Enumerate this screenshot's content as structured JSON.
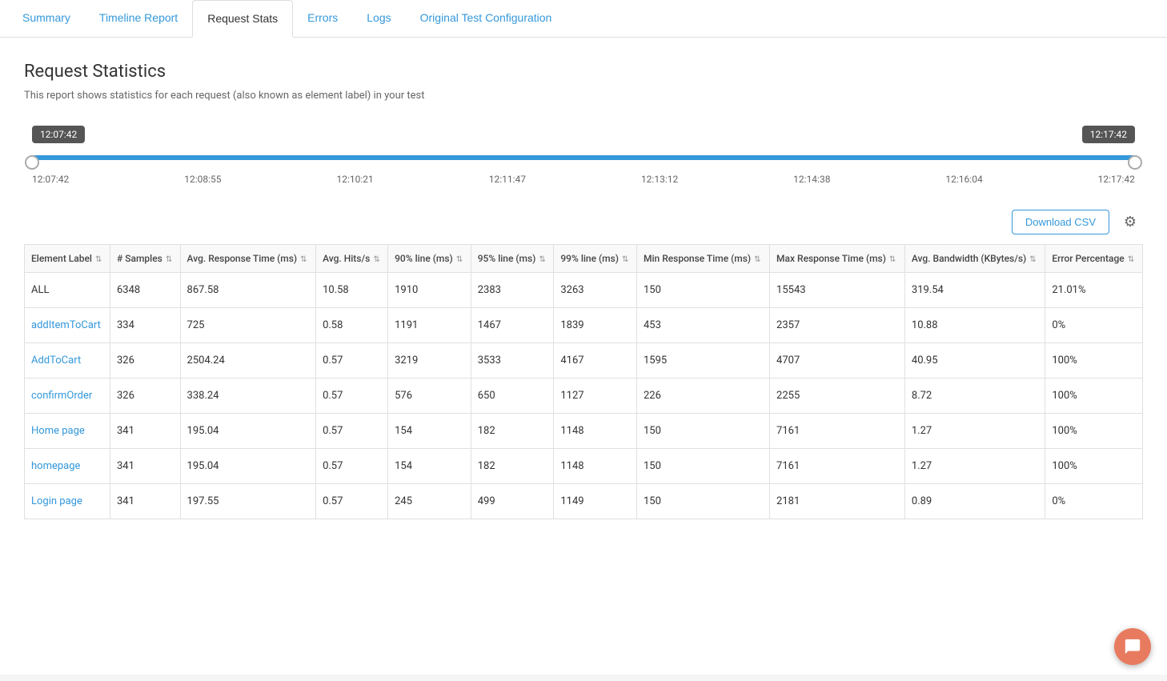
{
  "tabs": [
    {
      "id": "summary",
      "label": "Summary",
      "active": false
    },
    {
      "id": "timeline-report",
      "label": "Timeline Report",
      "active": false
    },
    {
      "id": "request-stats",
      "label": "Request Stats",
      "active": true
    },
    {
      "id": "errors",
      "label": "Errors",
      "active": false
    },
    {
      "id": "logs",
      "label": "Logs",
      "active": false
    },
    {
      "id": "original-test-config",
      "label": "Original Test Configuration",
      "active": false
    }
  ],
  "page": {
    "title": "Request Statistics",
    "subtitle": "This report shows statistics for each request (also known as element label) in your test"
  },
  "slider": {
    "start_time": "12:07:42",
    "end_time": "12:17:42",
    "time_labels": [
      "12:07:42",
      "12:08:55",
      "12:10:21",
      "12:11:47",
      "12:13:12",
      "12:14:38",
      "12:16:04",
      "12:17:42"
    ]
  },
  "toolbar": {
    "download_csv_label": "Download CSV"
  },
  "table": {
    "columns": [
      {
        "id": "element-label",
        "label": "Element Label",
        "sortable": true
      },
      {
        "id": "samples",
        "label": "# Samples",
        "sortable": true
      },
      {
        "id": "avg-response-time",
        "label": "Avg. Response Time (ms)",
        "sortable": true
      },
      {
        "id": "avg-hits",
        "label": "Avg. Hits/s",
        "sortable": true
      },
      {
        "id": "90line",
        "label": "90% line (ms)",
        "sortable": true
      },
      {
        "id": "95line",
        "label": "95% line (ms)",
        "sortable": true
      },
      {
        "id": "99line",
        "label": "99% line (ms)",
        "sortable": true
      },
      {
        "id": "min-response",
        "label": "Min Response Time (ms)",
        "sortable": true
      },
      {
        "id": "max-response",
        "label": "Max Response Time (ms)",
        "sortable": true
      },
      {
        "id": "avg-bandwidth",
        "label": "Avg. Bandwidth (KBytes/s)",
        "sortable": true
      },
      {
        "id": "error-pct",
        "label": "Error Percentage",
        "sortable": true
      }
    ],
    "rows": [
      {
        "label": "ALL",
        "samples": "6348",
        "avg_response": "867.58",
        "avg_hits": "10.58",
        "p90": "1910",
        "p95": "2383",
        "p99": "3263",
        "min_response": "150",
        "max_response": "15543",
        "avg_bandwidth": "319.54",
        "error_pct": "21.01%",
        "is_link": false
      },
      {
        "label": "addItemToCart",
        "samples": "334",
        "avg_response": "725",
        "avg_hits": "0.58",
        "p90": "1191",
        "p95": "1467",
        "p99": "1839",
        "min_response": "453",
        "max_response": "2357",
        "avg_bandwidth": "10.88",
        "error_pct": "0%",
        "is_link": true
      },
      {
        "label": "AddToCart",
        "samples": "326",
        "avg_response": "2504.24",
        "avg_hits": "0.57",
        "p90": "3219",
        "p95": "3533",
        "p99": "4167",
        "min_response": "1595",
        "max_response": "4707",
        "avg_bandwidth": "40.95",
        "error_pct": "100%",
        "is_link": true
      },
      {
        "label": "confirmOrder",
        "samples": "326",
        "avg_response": "338.24",
        "avg_hits": "0.57",
        "p90": "576",
        "p95": "650",
        "p99": "1127",
        "min_response": "226",
        "max_response": "2255",
        "avg_bandwidth": "8.72",
        "error_pct": "100%",
        "is_link": true
      },
      {
        "label": "Home page",
        "samples": "341",
        "avg_response": "195.04",
        "avg_hits": "0.57",
        "p90": "154",
        "p95": "182",
        "p99": "1148",
        "min_response": "150",
        "max_response": "7161",
        "avg_bandwidth": "1.27",
        "error_pct": "100%",
        "is_link": true
      },
      {
        "label": "homepage",
        "samples": "341",
        "avg_response": "195.04",
        "avg_hits": "0.57",
        "p90": "154",
        "p95": "182",
        "p99": "1148",
        "min_response": "150",
        "max_response": "7161",
        "avg_bandwidth": "1.27",
        "error_pct": "100%",
        "is_link": true
      },
      {
        "label": "Login page",
        "samples": "341",
        "avg_response": "197.55",
        "avg_hits": "0.57",
        "p90": "245",
        "p95": "499",
        "p99": "1149",
        "min_response": "150",
        "max_response": "2181",
        "avg_bandwidth": "0.89",
        "error_pct": "0%",
        "is_link": true
      }
    ]
  }
}
